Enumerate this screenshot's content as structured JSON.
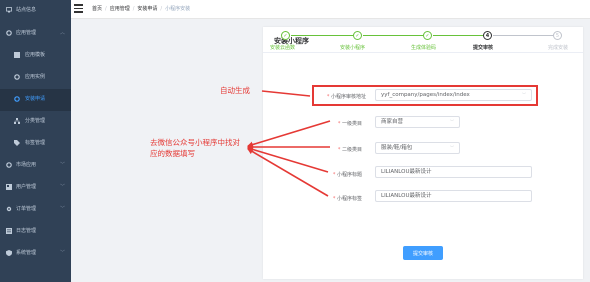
{
  "sidebar": {
    "items": [
      {
        "label": "站点信息",
        "has_children": false
      },
      {
        "label": "应用管理",
        "has_children": true
      },
      {
        "label": "应用模板",
        "sub": true
      },
      {
        "label": "应用实例",
        "sub": true
      },
      {
        "label": "安装申请",
        "sub": true,
        "active": true
      },
      {
        "label": "分类管理",
        "sub": true
      },
      {
        "label": "标签管理",
        "sub": true
      },
      {
        "label": "市场应用",
        "has_children": true
      },
      {
        "label": "用户管理",
        "has_children": true
      },
      {
        "label": "订单管理",
        "has_children": true
      },
      {
        "label": "日志管理",
        "has_children": false
      },
      {
        "label": "系统管理",
        "has_children": true
      }
    ]
  },
  "breadcrumb": [
    "首页",
    "应用管理",
    "安装申请",
    "小程序安装"
  ],
  "card": {
    "title": "安装小程序",
    "steps": [
      {
        "label": "安装云函数",
        "status": "done",
        "icon": "check-icon",
        "mark": "✓"
      },
      {
        "label": "安装小程序",
        "status": "done",
        "icon": "check-icon",
        "mark": "✓"
      },
      {
        "label": "生成体验码",
        "status": "done",
        "icon": "check-icon",
        "mark": "✓"
      },
      {
        "label": "提交审核",
        "status": "current",
        "number": "4"
      },
      {
        "label": "完成安装",
        "status": "wait",
        "number": "5"
      }
    ],
    "form": {
      "path": {
        "label": "小程序审核地址",
        "value": "yyf_company/pages/index/index",
        "required": true
      },
      "category1": {
        "label": "一级类目",
        "value": "商家自营",
        "required": true
      },
      "category2": {
        "label": "二级类目",
        "value": "服装/鞋/箱包",
        "required": true
      },
      "title": {
        "label": "小程序标题",
        "value": "LILIANLOU最新设计",
        "required": true
      },
      "tag": {
        "label": "小程序标签",
        "value": "LILIANLOU最新设计",
        "required": true
      }
    },
    "submit_label": "提交审核"
  },
  "annotations": {
    "auto_generate": "自动生成",
    "fill_from_wechat_line1": "去微信公众号小程序中找对",
    "fill_from_wechat_line2": "应的数据填写"
  },
  "colors": {
    "sidebar_bg": "#304156",
    "primary": "#409eff",
    "success": "#67c23a",
    "annotation_red": "#e53935"
  }
}
